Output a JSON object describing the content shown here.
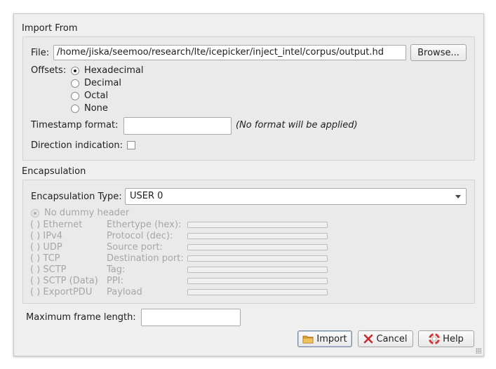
{
  "import_from": {
    "title": "Import From",
    "file_label": "File:",
    "file_value": "/home/jiska/seemoo/research/lte/icepicker/inject_intel/corpus/output.hd",
    "browse_label": "Browse...",
    "offsets_label": "Offsets:",
    "offsets": [
      "Hexadecimal",
      "Decimal",
      "Octal",
      "None"
    ],
    "offsets_selected": "Hexadecimal",
    "timestamp_label": "Timestamp format:",
    "timestamp_value": "",
    "timestamp_hint": "(No format will be applied)",
    "direction_label": "Direction indication:",
    "direction_checked": false
  },
  "encapsulation": {
    "title": "Encapsulation",
    "type_label": "Encapsulation Type:",
    "type_value": "USER 0",
    "dummy_header_label": "No dummy header",
    "headers": [
      {
        "radio": "( ) Ethernet",
        "field": "Ethertype (hex):"
      },
      {
        "radio": "( ) IPv4",
        "field": "Protocol (dec):"
      },
      {
        "radio": "( ) UDP",
        "field": "Source port:"
      },
      {
        "radio": "( ) TCP",
        "field": "Destination port:"
      },
      {
        "radio": "( ) SCTP",
        "field": "Tag:"
      },
      {
        "radio": "( ) SCTP (Data)",
        "field": "PPI:"
      },
      {
        "radio": "( ) ExportPDU",
        "field": "Payload"
      }
    ]
  },
  "max_frame": {
    "label": "Maximum frame length:",
    "value": ""
  },
  "buttons": {
    "import": "Import",
    "cancel": "Cancel",
    "help": "Help"
  },
  "colors": {
    "dialog_bg": "#efefef",
    "disabled_text": "#a6a6a6",
    "cancel_icon": "#cc2a2a",
    "help_icon": "#d23a3a",
    "folder_icon": "#e0a030"
  },
  "icons": {
    "import": "folder-icon",
    "cancel": "cancel-x-icon",
    "help": "help-lifebuoy-icon"
  }
}
